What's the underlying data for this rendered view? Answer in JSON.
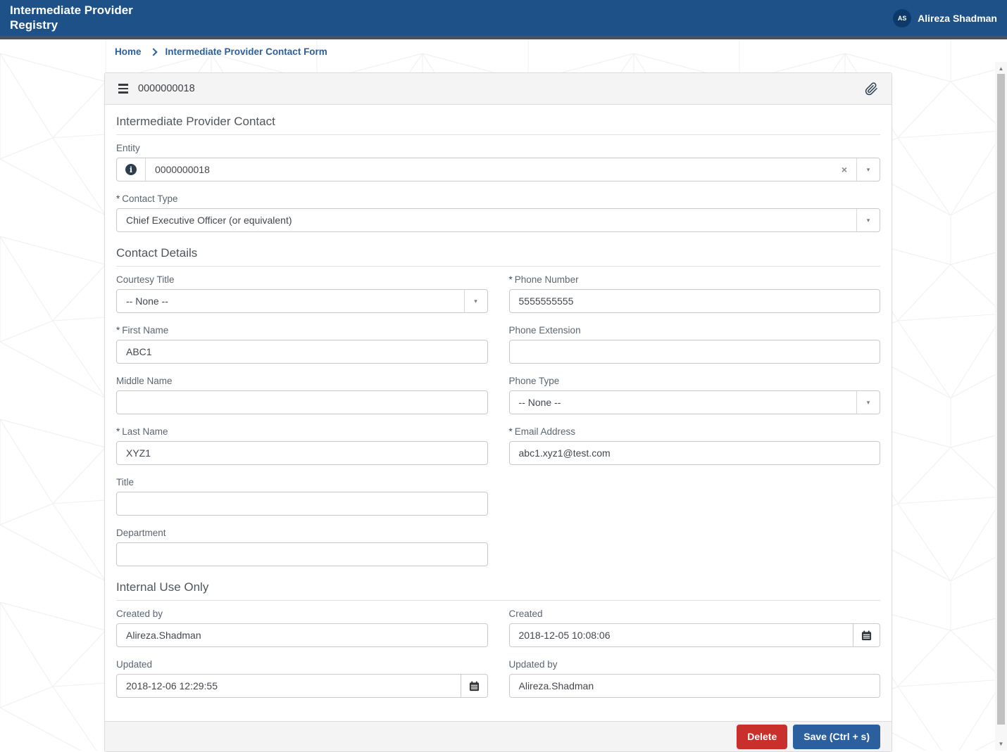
{
  "header": {
    "app_title": "Intermediate Provider Registry",
    "user": {
      "initials": "AS",
      "name": "Alireza Shadman"
    }
  },
  "breadcrumb": {
    "home": "Home",
    "current": "Intermediate Provider Contact Form"
  },
  "record": {
    "number": "0000000018"
  },
  "form": {
    "required_marker": "*",
    "sections": {
      "provider_contact": "Intermediate Provider Contact",
      "contact_details": "Contact Details",
      "internal_use": "Internal Use Only"
    },
    "fields": {
      "entity": {
        "label": "Entity",
        "value": "0000000018"
      },
      "contact_type": {
        "label": "Contact Type",
        "value": "Chief Executive Officer (or equivalent)"
      },
      "courtesy_title": {
        "label": "Courtesy Title",
        "value": "-- None --"
      },
      "phone_number": {
        "label": "Phone Number",
        "value": "5555555555"
      },
      "first_name": {
        "label": "First Name",
        "value": "ABC1"
      },
      "phone_extension": {
        "label": "Phone Extension",
        "value": ""
      },
      "middle_name": {
        "label": "Middle Name",
        "value": ""
      },
      "phone_type": {
        "label": "Phone Type",
        "value": "-- None --"
      },
      "last_name": {
        "label": "Last Name",
        "value": "XYZ1"
      },
      "email_address": {
        "label": "Email Address",
        "value": "abc1.xyz1@test.com"
      },
      "title": {
        "label": "Title",
        "value": ""
      },
      "department": {
        "label": "Department",
        "value": ""
      },
      "created_by": {
        "label": "Created by",
        "value": "Alireza.Shadman"
      },
      "created": {
        "label": "Created",
        "value": "2018-12-05 10:08:06"
      },
      "updated": {
        "label": "Updated",
        "value": "2018-12-06 12:29:55"
      },
      "updated_by": {
        "label": "Updated by",
        "value": "Alireza.Shadman"
      }
    }
  },
  "footer": {
    "delete_label": "Delete",
    "save_label": "Save (Ctrl + s)"
  },
  "icons": {
    "info": "i",
    "clear": "×",
    "dropdown": "▾",
    "scroll_up": "▲",
    "scroll_down": "▼"
  },
  "colors": {
    "header_bg": "#1d5187",
    "header_strip": "#47525e",
    "link_blue": "#2a609f",
    "delete_red": "#c9302c",
    "save_blue": "#2b5f9e"
  }
}
